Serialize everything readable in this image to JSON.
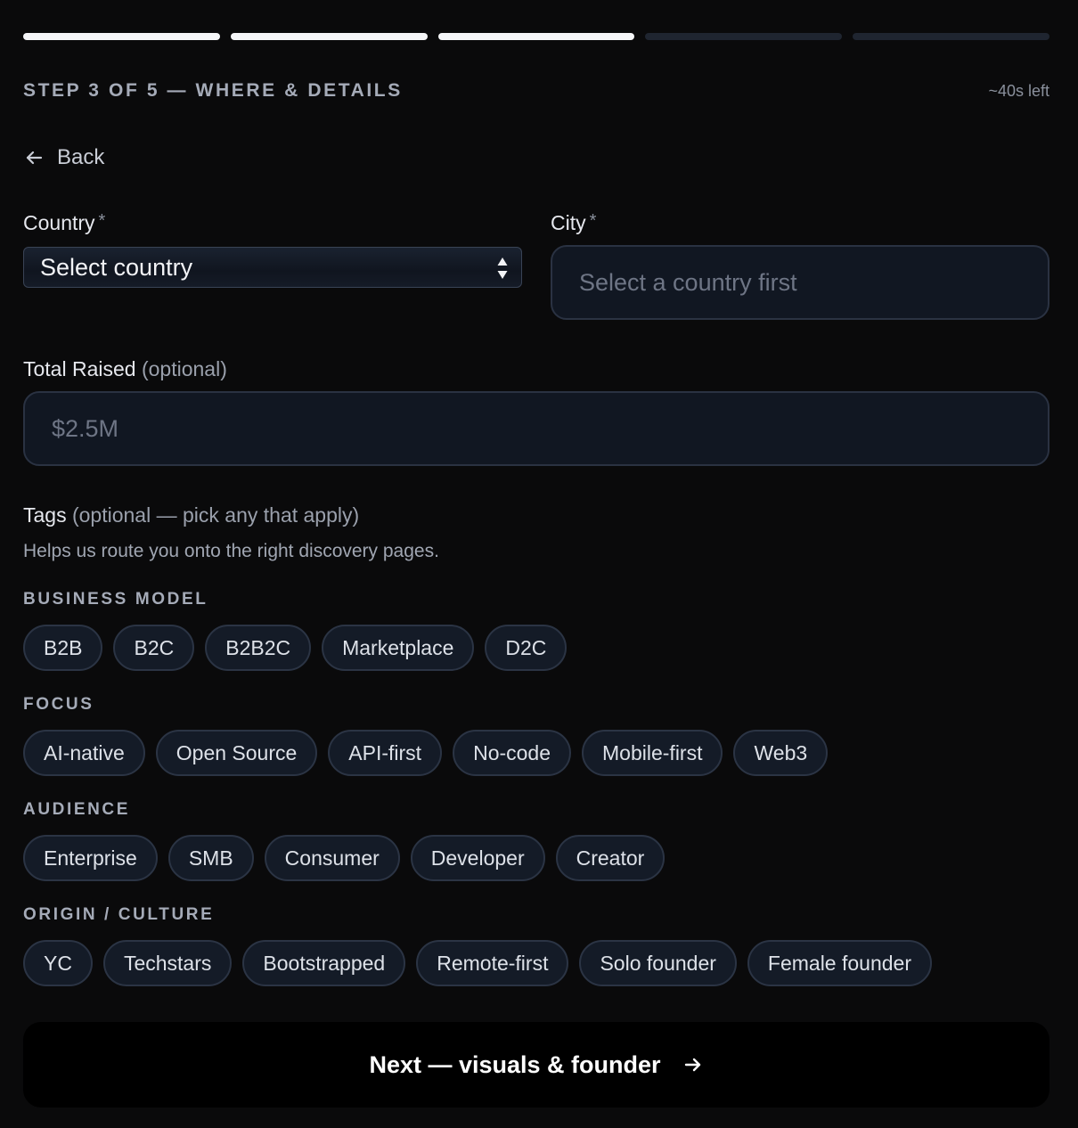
{
  "progress": {
    "total_steps": 5,
    "completed_steps": 3
  },
  "header": {
    "step_label": "STEP 3 OF 5 — WHERE & DETAILS",
    "time_left": "~40s left"
  },
  "back": {
    "label": "Back"
  },
  "country": {
    "label": "Country",
    "required_mark": "*",
    "selected": "Select country"
  },
  "city": {
    "label": "City",
    "required_mark": "*",
    "placeholder": "Select a country first"
  },
  "total_raised": {
    "label": "Total Raised",
    "optional": "(optional)",
    "placeholder": "$2.5M"
  },
  "tags": {
    "label": "Tags",
    "optional": "(optional — pick any that apply)",
    "help": "Helps us route you onto the right discovery pages."
  },
  "groups": [
    {
      "title": "BUSINESS MODEL",
      "chips": [
        "B2B",
        "B2C",
        "B2B2C",
        "Marketplace",
        "D2C"
      ]
    },
    {
      "title": "FOCUS",
      "chips": [
        "AI-native",
        "Open Source",
        "API-first",
        "No-code",
        "Mobile-first",
        "Web3"
      ]
    },
    {
      "title": "AUDIENCE",
      "chips": [
        "Enterprise",
        "SMB",
        "Consumer",
        "Developer",
        "Creator"
      ]
    },
    {
      "title": "ORIGIN / CULTURE",
      "chips": [
        "YC",
        "Techstars",
        "Bootstrapped",
        "Remote-first",
        "Solo founder",
        "Female founder"
      ]
    }
  ],
  "next": {
    "label": "Next — visuals & founder"
  },
  "icons": {
    "back": "arrow-left-icon",
    "next": "arrow-right-icon",
    "select": "chevron-updown-icon"
  },
  "colors": {
    "background": "#0a0a0b",
    "progress_done": "#f5f6f8",
    "progress_todo": "#1f2530",
    "chip_bg": "#141b27"
  }
}
